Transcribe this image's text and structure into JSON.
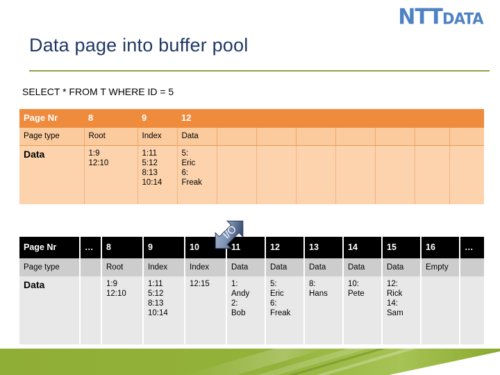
{
  "brand": {
    "logo_part1": "NTT",
    "logo_part2": "DaTa",
    "logo_color": "#4d82c3",
    "title_color": "#1f3864",
    "rule_color": "#8d9f45",
    "band_color": "#8cae34",
    "table1_header_color": "#ef8b3c",
    "table1_row_color": "#fbcb9e",
    "table1_data_color": "#fcd3ac",
    "table2_header_color": "#000000",
    "table2_row_color": "#cdcdcd",
    "table2_data_color": "#e8e8e8"
  },
  "slide": {
    "title": "Data page into buffer pool",
    "query": "SELECT * FROM T WHERE ID = 5"
  },
  "io_arrow": {
    "label": "I/O",
    "icon": "double-headed-diagonal-arrow-icon"
  },
  "table_top": {
    "name": "buffer-pool-table",
    "row_labels": [
      "Page Nr",
      "Page type",
      "Data"
    ],
    "columns": [
      {
        "page_nr": "8",
        "page_type": "Root",
        "data": [
          "1:9",
          "12:10"
        ]
      },
      {
        "page_nr": "9",
        "page_type": "Index",
        "data": [
          "1:11",
          "5:12",
          "8:13",
          "10:14"
        ]
      },
      {
        "page_nr": "12",
        "page_type": "Data",
        "data": [
          "5:",
          "Eric",
          "6:",
          "Freak"
        ]
      },
      {
        "page_nr": "",
        "page_type": "",
        "data": []
      },
      {
        "page_nr": "",
        "page_type": "",
        "data": []
      },
      {
        "page_nr": "",
        "page_type": "",
        "data": []
      },
      {
        "page_nr": "",
        "page_type": "",
        "data": []
      },
      {
        "page_nr": "",
        "page_type": "",
        "data": []
      },
      {
        "page_nr": "",
        "page_type": "",
        "data": []
      },
      {
        "page_nr": "",
        "page_type": "",
        "data": []
      }
    ]
  },
  "table_bottom": {
    "name": "disk-pages-table",
    "row_labels": [
      "Page Nr",
      "Page type",
      "Data"
    ],
    "columns": [
      {
        "page_nr": "…",
        "page_type": "",
        "data": []
      },
      {
        "page_nr": "8",
        "page_type": "Root",
        "data": [
          "1:9",
          "12:10"
        ]
      },
      {
        "page_nr": "9",
        "page_type": "Index",
        "data": [
          "1:11",
          "5:12",
          "8:13",
          "10:14"
        ]
      },
      {
        "page_nr": "10",
        "page_type": "Index",
        "data": [
          "12:15"
        ]
      },
      {
        "page_nr": "11",
        "page_type": "Data",
        "data": [
          "1:",
          "Andy",
          "2:",
          "Bob"
        ]
      },
      {
        "page_nr": "12",
        "page_type": "Data",
        "data": [
          "5:",
          "Eric",
          "6:",
          "Freak"
        ]
      },
      {
        "page_nr": "13",
        "page_type": "Data",
        "data": [
          "8:",
          "Hans"
        ]
      },
      {
        "page_nr": "14",
        "page_type": "Data",
        "data": [
          "10:",
          "Pete"
        ]
      },
      {
        "page_nr": "15",
        "page_type": "Data",
        "data": [
          "12:",
          "Rick",
          "14:",
          "Sam"
        ]
      },
      {
        "page_nr": "16",
        "page_type": "Empty",
        "data": []
      },
      {
        "page_nr": "…",
        "page_type": "",
        "data": []
      }
    ]
  }
}
